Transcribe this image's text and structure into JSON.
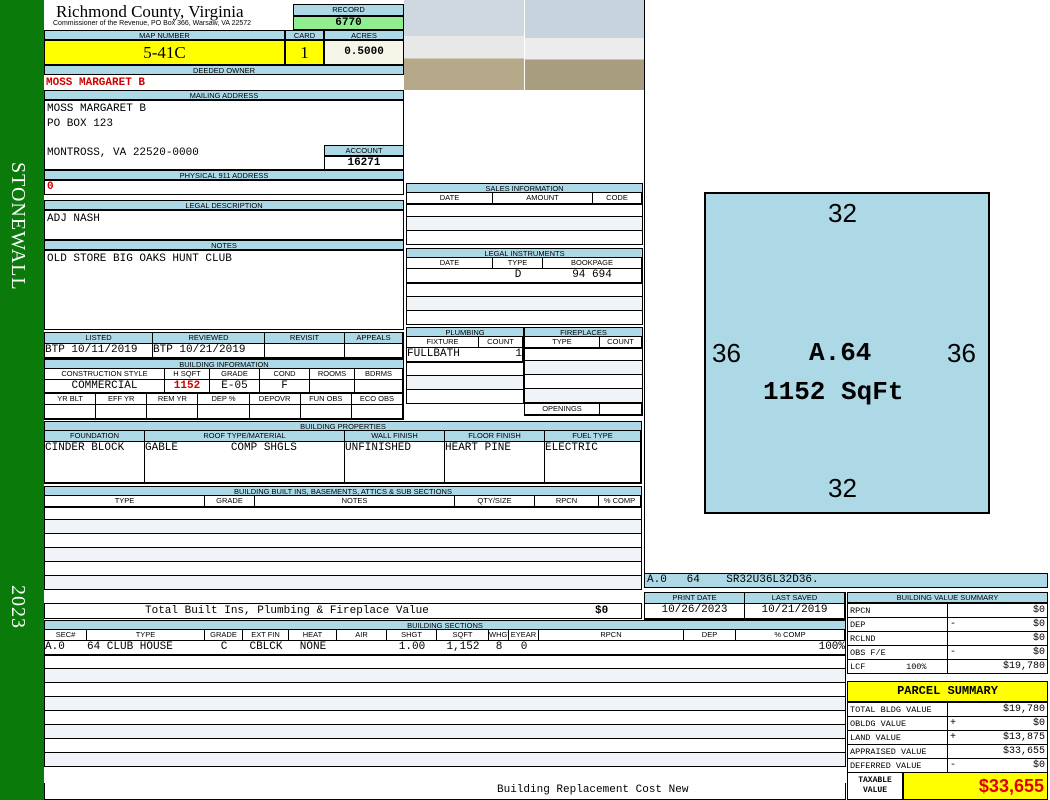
{
  "sidebar": {
    "district": "STONEWALL",
    "year": "2023"
  },
  "header": {
    "county": "Richmond County, Virginia",
    "subtitle": "Commissioner of the Revenue, PO Box 366, Warsaw, VA 22572",
    "record_label": "RECORD",
    "record": "6770"
  },
  "parcel": {
    "map_label": "MAP NUMBER",
    "map": "5-41C",
    "card_label": "CARD",
    "card": "1",
    "acres_label": "ACRES",
    "acres": "0.5000"
  },
  "owner": {
    "label": "DEEDED OWNER",
    "name": "MOSS MARGARET B"
  },
  "mailing": {
    "label": "MAILING ADDRESS",
    "line1": "MOSS MARGARET B",
    "line2": "PO BOX 123",
    "line3": "MONTROSS, VA 22520-0000",
    "account_label": "ACCOUNT",
    "account": "16271"
  },
  "physical": {
    "label": "PHYSICAL 911 ADDRESS",
    "value": "0"
  },
  "legal": {
    "label": "LEGAL DESCRIPTION",
    "value": "ADJ NASH"
  },
  "notes": {
    "label": "NOTES",
    "value": "OLD STORE BIG OAKS HUNT CLUB"
  },
  "review": {
    "headers": [
      "LISTED",
      "REVIEWED",
      "REVISIT",
      "APPEALS"
    ],
    "values": [
      "BTP 10/11/2019",
      "BTP 10/21/2019",
      "",
      ""
    ]
  },
  "building_info": {
    "label": "BUILDING INFORMATION",
    "headers1": [
      "CONSTRUCTION STYLE",
      "H SQFT",
      "GRADE",
      "COND",
      "ROOMS",
      "BDRMS"
    ],
    "values1": [
      "COMMERCIAL",
      "1152",
      "E-05",
      "F",
      "",
      ""
    ],
    "headers2": [
      "YR BLT",
      "EFF YR",
      "REM YR",
      "DEP %",
      "DEPOVR",
      "FUN OBS",
      "ECO OBS"
    ]
  },
  "sales": {
    "label": "SALES INFORMATION",
    "headers": [
      "DATE",
      "AMOUNT",
      "CODE"
    ]
  },
  "instruments": {
    "label": "LEGAL INSTRUMENTS",
    "headers": [
      "DATE",
      "TYPE",
      "BOOKPAGE"
    ],
    "row": [
      "",
      "D",
      "94 694"
    ]
  },
  "plumbing": {
    "label": "PLUMBING",
    "headers": [
      "FIXTURE",
      "COUNT"
    ],
    "row": [
      "FULLBATH",
      "1"
    ]
  },
  "fireplaces": {
    "label": "FIREPLACES",
    "headers": [
      "TYPE",
      "COUNT"
    ],
    "openings": "OPENINGS"
  },
  "properties": {
    "label": "BUILDING PROPERTIES",
    "headers": [
      "FOUNDATION",
      "ROOF TYPE/MATERIAL",
      "WALL FINISH",
      "FLOOR FINISH",
      "FUEL TYPE"
    ],
    "values": [
      "CINDER BLOCK",
      "GABLE        COMP SHGLS",
      "UNFINISHED",
      "HEART PINE",
      "ELECTRIC"
    ]
  },
  "builtins": {
    "label": "BUILDING BUILT INS, BASEMENTS, ATTICS & SUB SECTIONS",
    "headers": [
      "TYPE",
      "GRADE",
      "NOTES",
      "QTY/SIZE",
      "RPCN",
      "% COMP"
    ],
    "total_label": "Total Built Ins, Plumbing & Fireplace Value",
    "total": "$0"
  },
  "sections": {
    "label": "BUILDING SECTIONS",
    "headers": [
      "SEC#",
      "TYPE",
      "GRADE",
      "EXT FIN",
      "HEAT",
      "AIR",
      "SHGT",
      "SQFT",
      "WHGT",
      "EYEAR",
      "RPCN",
      "DEP",
      "% COMP"
    ],
    "row": [
      "A.0",
      "64 CLUB HOUSE",
      "C",
      "CBLCK",
      "NONE",
      "",
      "1.00",
      "1,152",
      "8",
      "0",
      "",
      "",
      "100%"
    ],
    "footer": "Building Replacement Cost New"
  },
  "sketch": {
    "top": "32",
    "bottom": "32",
    "left": "36",
    "right": "36",
    "area": "A.64",
    "sqft": "1152 SqFt",
    "caption": "A.0   64    SR32U36L32D36."
  },
  "dates": {
    "print_label": "PRINT DATE",
    "print": "10/26/2023",
    "saved_label": "LAST SAVED",
    "saved": "10/21/2019"
  },
  "value_summary": {
    "label": "BUILDING VALUE SUMMARY",
    "rows": [
      {
        "name": "RPCN",
        "op": "",
        "value": "$0"
      },
      {
        "name": "DEP",
        "op": "-",
        "value": "$0"
      },
      {
        "name": "RCLND",
        "op": "",
        "value": "$0"
      },
      {
        "name": "OBS F/E",
        "op": "-",
        "value": "$0"
      },
      {
        "name": "LCF        100%",
        "op": "",
        "value": "$19,780"
      }
    ]
  },
  "parcel_summary": {
    "label": "PARCEL SUMMARY",
    "rows": [
      {
        "name": "TOTAL BLDG VALUE",
        "op": "",
        "value": "$19,780"
      },
      {
        "name": "OBLDG VALUE",
        "op": "+",
        "value": "$0"
      },
      {
        "name": "LAND VALUE",
        "op": "+",
        "value": "$13,875"
      },
      {
        "name": "APPRAISED VALUE",
        "op": "",
        "value": "$33,655"
      },
      {
        "name": "DEFERRED VALUE",
        "op": "-",
        "value": "$0"
      }
    ],
    "taxable_label": "TAXABLE VALUE",
    "taxable": "$33,655"
  },
  "colors": {
    "label_bg": "#add8e6",
    "yellow": "#ffff00",
    "green": "#0a7a0a",
    "record_bg": "#90ee90",
    "red": "#d00000"
  }
}
